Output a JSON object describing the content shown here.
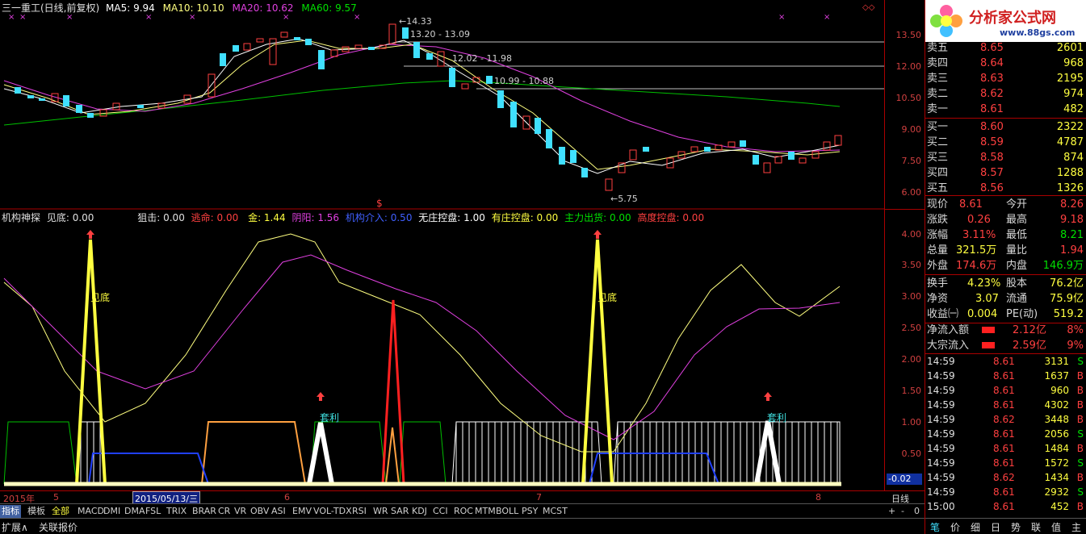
{
  "header": {
    "title": "三一重工(日线,前复权)",
    "ma5": "MA5: 9.94",
    "ma10": "MA10: 10.10",
    "ma20": "MA20: 10.62",
    "ma60": "MA60: 9.57"
  },
  "price_annotations": {
    "high": "14.33",
    "range1": "13.20 - 13.09",
    "range2": "12.02 - 11.98",
    "range3": "10.99 - 10.88",
    "low": "5.75"
  },
  "price_axis": [
    "13.50",
    "12.00",
    "10.50",
    "9.00",
    "7.50",
    "6.00"
  ],
  "indicator_header": {
    "name": "机构神探",
    "jiandi": "见底: 0.00",
    "juji": "狙击: 0.00",
    "taoming": "逃命: 0.00",
    "jin": "金: 1.44",
    "yinyang": "阴阳: 1.56",
    "jigou": "机构介入: 0.50",
    "wuzhuang": "无庄控盘: 1.00",
    "youzhuang": "有庄控盘: 0.00",
    "zhuli": "主力出货: 0.00",
    "gaodu": "高度控盘: 0.00"
  },
  "indicator_axis": [
    "4.00",
    "3.50",
    "3.00",
    "2.50",
    "2.00",
    "1.50",
    "1.00",
    "0.50"
  ],
  "indicator_labels": {
    "jiandi1": "见底",
    "jiandi2": "见底",
    "taoli1": "套利",
    "taoli2": "套利",
    "current": "-0.02"
  },
  "date_axis": {
    "year": "2015年",
    "m5": "5",
    "selected": "2015/05/13/三",
    "m6": "6",
    "m7": "7",
    "m8": "8",
    "period": "日线"
  },
  "tabs": [
    "指标",
    "模板",
    "全部",
    "MACD",
    "DMI",
    "DMA",
    "FSL",
    "TRIX",
    "BRAR",
    "CR",
    "VR",
    "OBV",
    "ASI",
    "EMV",
    "VOL-TDX",
    "RSI",
    "WR",
    "SAR",
    "KDJ",
    "CCI",
    "ROC",
    "MTM",
    "BOLL",
    "PSY",
    "MCST"
  ],
  "bottom_bar": {
    "expand": "扩展∧",
    "linked": "关联报价",
    "plus": "+",
    "minus": "-",
    "zero": "0"
  },
  "logo": {
    "text": "分析家公式网",
    "url": "www.88gs.com"
  },
  "order_book": {
    "sell": [
      {
        "label": "卖五",
        "price": "8.65",
        "vol": "2601"
      },
      {
        "label": "卖四",
        "price": "8.64",
        "vol": "968"
      },
      {
        "label": "卖三",
        "price": "8.63",
        "vol": "2195"
      },
      {
        "label": "卖二",
        "price": "8.62",
        "vol": "974"
      },
      {
        "label": "卖一",
        "price": "8.61",
        "vol": "482"
      }
    ],
    "buy": [
      {
        "label": "买一",
        "price": "8.60",
        "vol": "2322"
      },
      {
        "label": "买二",
        "price": "8.59",
        "vol": "4787"
      },
      {
        "label": "买三",
        "price": "8.58",
        "vol": "874"
      },
      {
        "label": "买四",
        "price": "8.57",
        "vol": "1288"
      },
      {
        "label": "买五",
        "price": "8.56",
        "vol": "1326"
      }
    ]
  },
  "stats": {
    "xianjia_l": "现价",
    "xianjia": "8.61",
    "jinkai_l": "今开",
    "jinkai": "8.26",
    "zhangdie_l": "涨跌",
    "zhangdie": "0.26",
    "zuigao_l": "最高",
    "zuigao": "9.18",
    "zhangfu_l": "涨幅",
    "zhangfu": "3.11%",
    "zuidi_l": "最低",
    "zuidi": "8.21",
    "zongliang_l": "总量",
    "zongliang": "321.5万",
    "liangbi_l": "量比",
    "liangbi": "1.94",
    "waipan_l": "外盘",
    "waipan": "174.6万",
    "neipan_l": "内盘",
    "neipan": "146.9万",
    "huanshou_l": "换手",
    "huanshou": "4.23%",
    "guben_l": "股本",
    "guben": "76.2亿",
    "jingzi_l": "净资",
    "jingzi": "3.07",
    "liutong_l": "流通",
    "liutong": "75.9亿",
    "shouyi_l": "收益㈠",
    "shouyi": "0.004",
    "pe_l": "PE(动)",
    "pe": "519.2",
    "jingliuru_l": "净流入额",
    "jingliuru": "2.12亿",
    "jingliuru_pct": "8%",
    "dazong_l": "大宗流入",
    "dazong": "2.59亿",
    "dazong_pct": "9%"
  },
  "ticks": [
    {
      "time": "14:59",
      "price": "8.61",
      "vol": "3131",
      "side": "S"
    },
    {
      "time": "14:59",
      "price": "8.61",
      "vol": "1637",
      "side": "B"
    },
    {
      "time": "14:59",
      "price": "8.61",
      "vol": "960",
      "side": "B"
    },
    {
      "time": "14:59",
      "price": "8.61",
      "vol": "4302",
      "side": "B"
    },
    {
      "time": "14:59",
      "price": "8.62",
      "vol": "3448",
      "side": "B"
    },
    {
      "time": "14:59",
      "price": "8.61",
      "vol": "2056",
      "side": "S"
    },
    {
      "time": "14:59",
      "price": "8.61",
      "vol": "1484",
      "side": "B"
    },
    {
      "time": "14:59",
      "price": "8.61",
      "vol": "1572",
      "side": "S"
    },
    {
      "time": "14:59",
      "price": "8.62",
      "vol": "1434",
      "side": "B"
    },
    {
      "time": "14:59",
      "price": "8.61",
      "vol": "2932",
      "side": "S"
    },
    {
      "time": "15:00",
      "price": "8.61",
      "vol": "452",
      "side": "B"
    }
  ],
  "quote_tabs": [
    "笔",
    "价",
    "细",
    "日",
    "势",
    "联",
    "值",
    "主"
  ]
}
